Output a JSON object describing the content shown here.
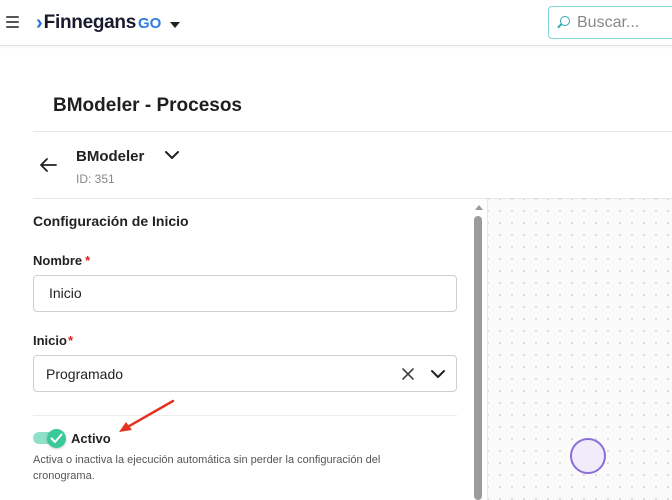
{
  "app": {
    "brand_name": "Finnegans",
    "brand_suffix": "GO",
    "brand_color": "#2f7de1",
    "menu_icon": "hamburger-menu-icon"
  },
  "search": {
    "placeholder": "Buscar..."
  },
  "page": {
    "title": "BModeler - Procesos"
  },
  "process": {
    "name": "BModeler",
    "id_label": "ID: 351"
  },
  "form": {
    "section_title": "Configuración de Inicio",
    "nombre": {
      "label": "Nombre",
      "required_mark": "*",
      "value": "Inicio"
    },
    "inicio": {
      "label": "Inicio",
      "required_mark": "*",
      "selected": "Programado"
    },
    "activo": {
      "label": "Activo",
      "enabled": true,
      "help": "Activa o inactiva la ejecución automática sin perder la configuración del cronograma."
    }
  },
  "colors": {
    "accent_teal": "#2aa9b3",
    "toggle_on": "#3bc99a",
    "required": "#e02020",
    "annotation_arrow": "#e53322",
    "node_stroke": "#8b6fd6"
  }
}
